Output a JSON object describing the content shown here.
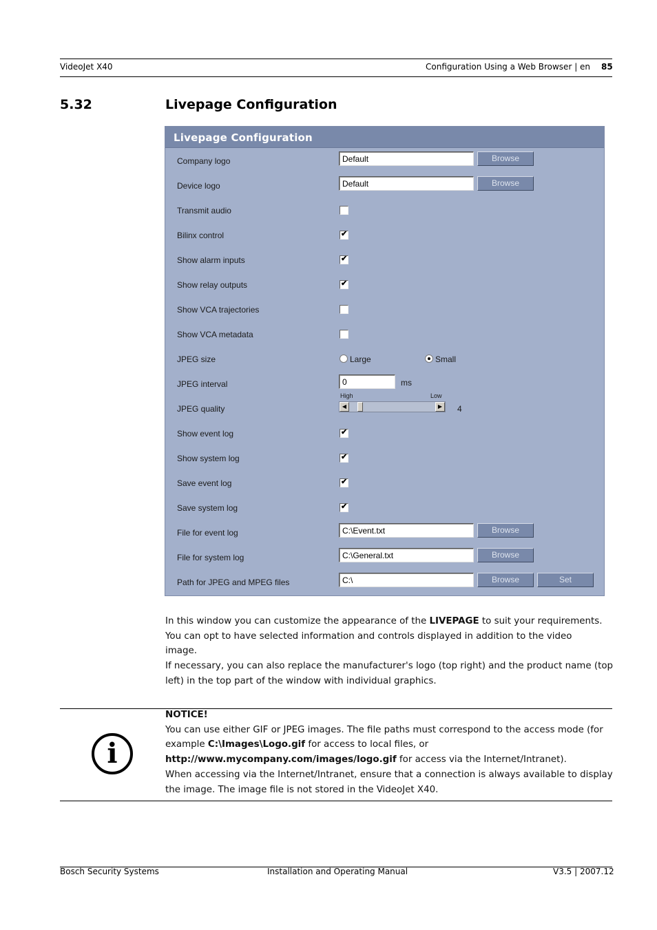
{
  "header": {
    "left": "VideoJet X40",
    "right": "Configuration Using a Web Browser | en",
    "page_number": "85"
  },
  "section": {
    "number": "5.32",
    "title": "Livepage Configuration"
  },
  "panel": {
    "title": "Livepage Configuration",
    "browse_label": "Browse",
    "set_label": "Set",
    "rows": {
      "company_logo": {
        "label": "Company logo",
        "value": "Default"
      },
      "device_logo": {
        "label": "Device logo",
        "value": "Default"
      },
      "transmit_audio": {
        "label": "Transmit audio",
        "checked": false
      },
      "bilinx_control": {
        "label": "Bilinx control",
        "checked": true
      },
      "show_alarm_inputs": {
        "label": "Show alarm inputs",
        "checked": true
      },
      "show_relay_outputs": {
        "label": "Show relay outputs",
        "checked": true
      },
      "show_vca_trajectories": {
        "label": "Show VCA trajectories",
        "checked": false
      },
      "show_vca_metadata": {
        "label": "Show VCA metadata",
        "checked": false
      },
      "jpeg_size": {
        "label": "JPEG size",
        "options": [
          "Large",
          "Small"
        ],
        "selected": "Small"
      },
      "jpeg_interval": {
        "label": "JPEG interval",
        "value": "0",
        "unit": "ms"
      },
      "jpeg_quality": {
        "label": "JPEG quality",
        "min_label": "High",
        "max_label": "Low",
        "value": "4",
        "position_fraction": 0.1
      },
      "show_event_log": {
        "label": "Show event log",
        "checked": true
      },
      "show_system_log": {
        "label": "Show system log",
        "checked": true
      },
      "save_event_log": {
        "label": "Save event log",
        "checked": true
      },
      "save_system_log": {
        "label": "Save system log",
        "checked": true
      },
      "file_event_log": {
        "label": "File for event log",
        "value": "C:\\Event.txt"
      },
      "file_system_log": {
        "label": "File for system log",
        "value": "C:\\General.txt"
      },
      "path_jpeg_mpeg": {
        "label": "Path for JPEG and MPEG files",
        "value": "C:\\"
      }
    },
    "check_mark": "✔"
  },
  "description": {
    "p1_a": "In this window you can customize the appearance of the ",
    "p1_bold": "LIVEPAGE",
    "p1_b": " to suit your requirements.",
    "p2": "You can opt to have selected information and controls displayed in addition to the video image.",
    "p3": "If necessary, you can also replace the manufacturer's logo (top right) and the product name (top left) in the top part of the window with individual graphics."
  },
  "notice": {
    "icon_glyph": "i",
    "heading": "NOTICE!",
    "t1": "You can use either GIF or JPEG images. The file paths must correspond to the access mode (for example ",
    "b1": "C:\\Images\\Logo.gif",
    "t2": " for access to local files, or ",
    "b2": "http://www.mycompany.com/images/logo.gif",
    "t3": " for access via the Internet/Intranet).",
    "t4": "When accessing via the Internet/Intranet, ensure that a connection is always available to display the image. The image file is not stored in the VideoJet X40."
  },
  "footer": {
    "left": "Bosch Security Systems",
    "center": "Installation and Operating Manual",
    "right": "V3.5 | 2007.12"
  }
}
